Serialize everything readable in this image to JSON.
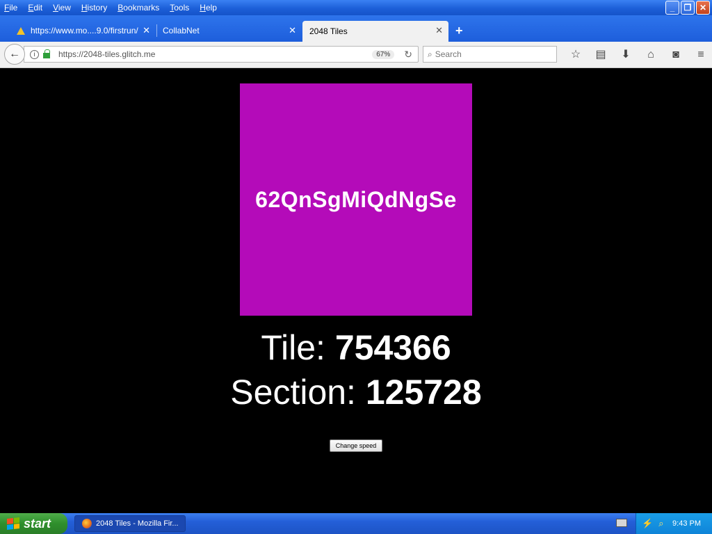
{
  "menu": [
    "File",
    "Edit",
    "View",
    "History",
    "Bookmarks",
    "Tools",
    "Help"
  ],
  "window_buttons": {
    "minimize": "_",
    "restore": "❐",
    "close": "✕"
  },
  "tabs": [
    {
      "label": "https://www.mo....9.0/firstrun/",
      "icon": "warning-icon"
    },
    {
      "label": "CollabNet"
    },
    {
      "label": "2048 Tiles",
      "active": true
    }
  ],
  "tab_close_glyph": "✕",
  "new_tab_glyph": "+",
  "nav": {
    "url": "https://2048-tiles.glitch.me",
    "zoom": "67%",
    "search_placeholder": "Search"
  },
  "page": {
    "tile_text": "62QnSgMiQdNgSe",
    "tile_color": "#b40bb9",
    "tile_label": "Tile:",
    "tile_value": "754366",
    "section_label": "Section:",
    "section_value": "125728",
    "speed_button": "Change speed"
  },
  "taskbar": {
    "start_label": "start",
    "task_label": "2048 Tiles - Mozilla Fir...",
    "clock": "9:43 PM"
  }
}
